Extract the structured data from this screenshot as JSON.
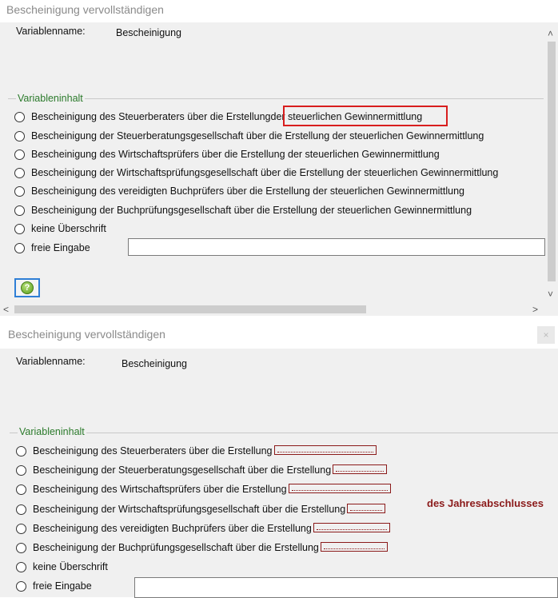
{
  "top": {
    "window_title": "Bescheinigung vervollständigen",
    "variable_label": "Variablenname:",
    "variable_value": "Bescheinigung",
    "group_label": "Variableninhalt",
    "options": [
      {
        "label": "Bescheinigung des Steuerberaters über die  Erstellung ",
        "highlight": "der steuerlichen Gewinnermittlung"
      },
      {
        "label": "Bescheinigung der Steuerberatungsgesellschaft über die  Erstellung der steuerlichen Gewinnermittlung"
      },
      {
        "label": "Bescheinigung des Wirtschaftsprüfers über die  Erstellung der steuerlichen Gewinnermittlung"
      },
      {
        "label": "Bescheinigung der Wirtschaftsprüfungsgesellschaft über die  Erstellung der steuerlichen Gewinnermittlung"
      },
      {
        "label": "Bescheinigung des vereidigten Buchprüfers über die  Erstellung der steuerlichen Gewinnermittlung"
      },
      {
        "label": "Bescheinigung der Buchprüfungsgesellschaft über die  Erstellung der steuerlichen Gewinnermittlung"
      },
      {
        "label": "keine Überschrift"
      },
      {
        "label": "freie Eingabe"
      }
    ],
    "free_input_value": "",
    "help_icon": "help-icon",
    "scroll_up_icon": "˄",
    "scroll_down_icon": "˅",
    "scroll_left_icon": "<",
    "scroll_right_icon": ">"
  },
  "bottom": {
    "window_title": "Bescheinigung vervollständigen",
    "close_icon": "×",
    "variable_label": "Variablenname:",
    "variable_value": "Bescheinigung",
    "group_label": "Variableninhalt",
    "options": [
      {
        "label": "Bescheinigung des Steuerberaters über die  Erstellung"
      },
      {
        "label": "Bescheinigung der Steuerberatungsgesellschaft über die  Erstellung"
      },
      {
        "label": "Bescheinigung des Wirtschaftsprüfers über die  Erstellung"
      },
      {
        "label": "Bescheinigung der Wirtschaftsprüfungsgesellschaft über die  Erstellung"
      },
      {
        "label": "Bescheinigung des vereidigten Buchprüfers über die  Erstellung"
      },
      {
        "label": "Bescheinigung der Buchprüfungsgesellschaft über die  Erstellung"
      },
      {
        "label": "keine Überschrift"
      },
      {
        "label": "freie Eingabe"
      }
    ],
    "placeholder_suffix": "des Jahresabschlusses",
    "free_input_value": ""
  },
  "colors": {
    "highlight": "#d81e1e",
    "placeholder": "#8b1a1a",
    "group_label": "#2b7a2b",
    "help_border": "#2f7fd6"
  }
}
